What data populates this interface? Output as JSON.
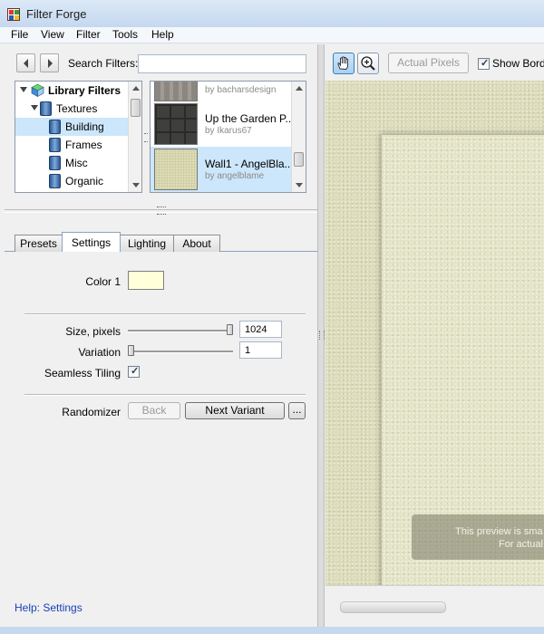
{
  "window": {
    "title": "Filter Forge"
  },
  "menu": [
    "File",
    "View",
    "Filter",
    "Tools",
    "Help"
  ],
  "search": {
    "label": "Search Filters:",
    "value": ""
  },
  "tree": [
    {
      "label": "Library Filters",
      "icon": "library-cube-icon",
      "expanded": true
    },
    {
      "label": "Textures",
      "icon": "folder-icon",
      "expanded": true
    },
    {
      "label": "Building",
      "icon": "folder-icon",
      "selected": true
    },
    {
      "label": "Frames",
      "icon": "folder-icon"
    },
    {
      "label": "Misc",
      "icon": "folder-icon"
    },
    {
      "label": "Organic",
      "icon": "folder-icon"
    }
  ],
  "filters": [
    {
      "title": "",
      "author": "by bacharsdesign"
    },
    {
      "title": "Up the Garden P...",
      "author": "by Ikarus67"
    },
    {
      "title": "Wall1 - AngelBla...",
      "author": "by angelblame",
      "selected": true
    }
  ],
  "tabs": [
    "Presets",
    "Settings",
    "Lighting",
    "About"
  ],
  "active_tab": "Settings",
  "settings": {
    "color1_label": "Color 1",
    "color1_value": "#ffffd9",
    "size_label": "Size, pixels",
    "size_value": "1024",
    "variation_label": "Variation",
    "variation_value": "1",
    "seamless_label": "Seamless Tiling",
    "seamless_checked": true,
    "randomizer_label": "Randomizer",
    "back_label": "Back",
    "next_label": "Next Variant",
    "more_label": "..."
  },
  "help_link": "Help: Settings",
  "preview_toolbar": {
    "actual_pixels_label": "Actual Pixels",
    "show_border_label": "Show Bord",
    "show_border_checked": true
  },
  "preview_notice": {
    "line1": "This preview is sma",
    "line2": "For actual"
  }
}
